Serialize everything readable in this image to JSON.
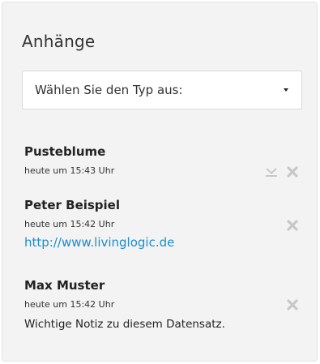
{
  "panel": {
    "title": "Anhänge"
  },
  "type_select": {
    "selected": "Wählen Sie den Typ aus:"
  },
  "attachments": [
    {
      "name": "Pusteblume",
      "time": "heute um 15:43 Uhr",
      "icons": [
        "download-icon",
        "delete-icon"
      ]
    },
    {
      "name": "Peter Beispiel",
      "time": "heute um 15:42 Uhr",
      "link": "http://www.livinglogic.de",
      "icons": [
        "delete-icon"
      ]
    },
    {
      "name": "Max Muster",
      "time": "heute um 15:42 Uhr",
      "note": "Wichtige Notiz zu diesem Datensatz.",
      "icons": [
        "delete-icon"
      ]
    }
  ],
  "colors": {
    "panel_bg": "#f3f3f3",
    "link": "#1a8ccf",
    "icon": "#c8c8c8"
  }
}
